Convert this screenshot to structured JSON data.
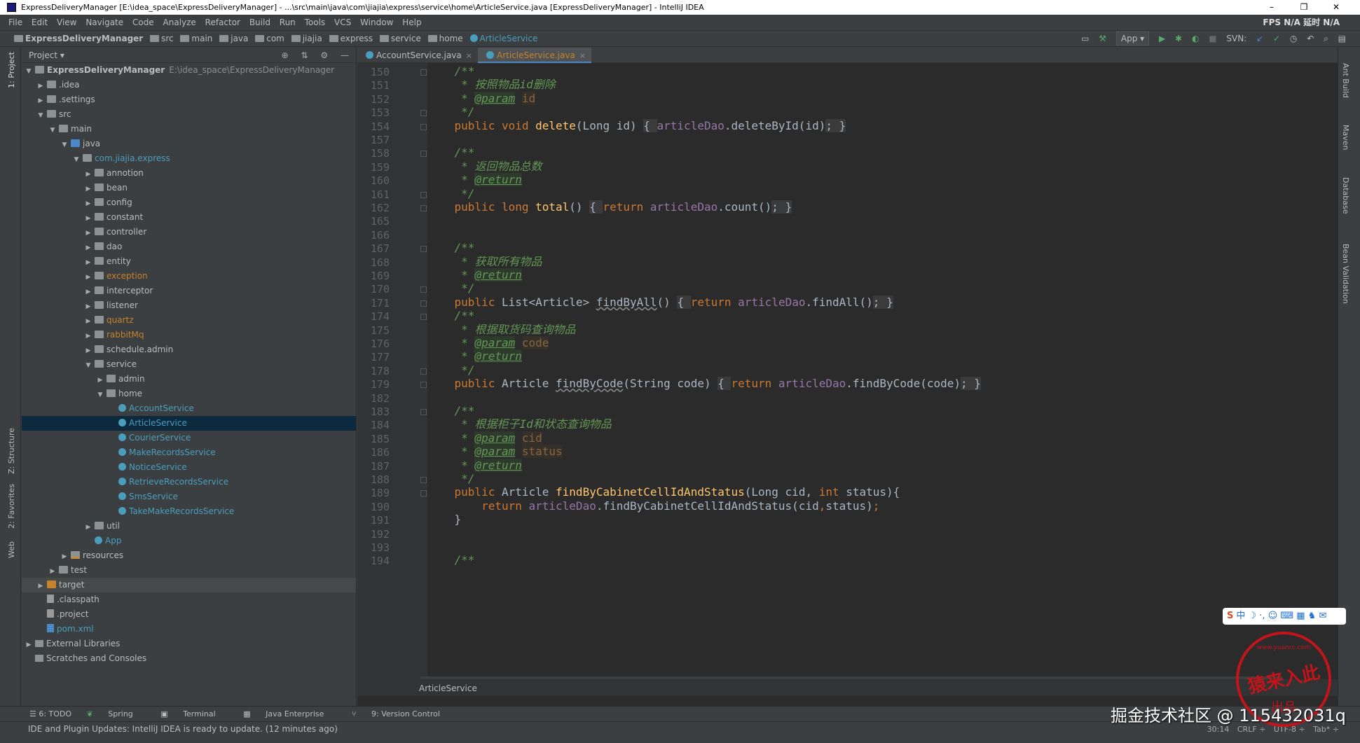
{
  "window": {
    "title": "ExpressDeliveryManager [E:\\idea_space\\ExpressDeliveryManager] - ...\\src\\main\\java\\com\\jiajia\\express\\service\\home\\ArticleService.java [ExpressDeliveryManager] - IntelliJ IDEA",
    "minimize": "–",
    "maximize": "❐",
    "close": "✕"
  },
  "menu": {
    "items": [
      "File",
      "Edit",
      "View",
      "Navigate",
      "Code",
      "Analyze",
      "Refactor",
      "Build",
      "Run",
      "Tools",
      "VCS",
      "Window",
      "Help"
    ],
    "fps": "FPS N/A 延时 N/A"
  },
  "nav": {
    "crumbs": [
      "ExpressDeliveryManager",
      "src",
      "main",
      "java",
      "com",
      "jiajia",
      "express",
      "service",
      "home",
      "ArticleService"
    ],
    "run_config": "App ▾",
    "svn": "SVN:"
  },
  "left_strip": {
    "project": "1: Project",
    "structure": "Z: Structure",
    "favorites": "2: Favorites",
    "web": "Web"
  },
  "right_strip": {
    "ant": "Ant Build",
    "maven": "Maven",
    "database": "Database",
    "bean": "Bean Validation"
  },
  "project_panel": {
    "title": "Project ▾",
    "tree": [
      {
        "depth": 0,
        "arrow": "▼",
        "icon": "folder",
        "label": "ExpressDeliveryManager",
        "path": "E:\\idea_space\\ExpressDeliveryManager",
        "style": "bold"
      },
      {
        "depth": 1,
        "arrow": "▶",
        "icon": "folder",
        "label": ".idea"
      },
      {
        "depth": 1,
        "arrow": "▶",
        "icon": "folder",
        "label": ".settings"
      },
      {
        "depth": 1,
        "arrow": "▼",
        "icon": "folder",
        "label": "src"
      },
      {
        "depth": 2,
        "arrow": "▼",
        "icon": "folder",
        "label": "main"
      },
      {
        "depth": 3,
        "arrow": "▼",
        "icon": "srcf",
        "label": "java"
      },
      {
        "depth": 4,
        "arrow": "▼",
        "icon": "folder",
        "label": "com.jiajia.express",
        "style": "hl"
      },
      {
        "depth": 5,
        "arrow": "▶",
        "icon": "folder",
        "label": "annotion"
      },
      {
        "depth": 5,
        "arrow": "▶",
        "icon": "folder",
        "label": "bean"
      },
      {
        "depth": 5,
        "arrow": "▶",
        "icon": "folder",
        "label": "config"
      },
      {
        "depth": 5,
        "arrow": "▶",
        "icon": "folder",
        "label": "constant"
      },
      {
        "depth": 5,
        "arrow": "▶",
        "icon": "folder",
        "label": "controller"
      },
      {
        "depth": 5,
        "arrow": "▶",
        "icon": "folder",
        "label": "dao"
      },
      {
        "depth": 5,
        "arrow": "▶",
        "icon": "folder",
        "label": "entity"
      },
      {
        "depth": 5,
        "arrow": "▶",
        "icon": "folder",
        "label": "exception",
        "style": "warn"
      },
      {
        "depth": 5,
        "arrow": "▶",
        "icon": "folder",
        "label": "interceptor"
      },
      {
        "depth": 5,
        "arrow": "▶",
        "icon": "folder",
        "label": "listener"
      },
      {
        "depth": 5,
        "arrow": "▶",
        "icon": "folder",
        "label": "quartz",
        "style": "warn"
      },
      {
        "depth": 5,
        "arrow": "▶",
        "icon": "folder",
        "label": "rabbitMq",
        "style": "warn"
      },
      {
        "depth": 5,
        "arrow": "▶",
        "icon": "folder",
        "label": "schedule.admin"
      },
      {
        "depth": 5,
        "arrow": "▼",
        "icon": "folder",
        "label": "service"
      },
      {
        "depth": 6,
        "arrow": "▶",
        "icon": "folder",
        "label": "admin"
      },
      {
        "depth": 6,
        "arrow": "▼",
        "icon": "folder",
        "label": "home"
      },
      {
        "depth": 7,
        "arrow": "",
        "icon": "cls",
        "label": "AccountService",
        "style": "hl"
      },
      {
        "depth": 7,
        "arrow": "",
        "icon": "cls",
        "label": "ArticleService",
        "style": "hl",
        "selected": true
      },
      {
        "depth": 7,
        "arrow": "",
        "icon": "cls",
        "label": "CourierService",
        "style": "hl"
      },
      {
        "depth": 7,
        "arrow": "",
        "icon": "cls",
        "label": "MakeRecordsService",
        "style": "hl"
      },
      {
        "depth": 7,
        "arrow": "",
        "icon": "cls",
        "label": "NoticeService",
        "style": "hl"
      },
      {
        "depth": 7,
        "arrow": "",
        "icon": "cls",
        "label": "RetrieveRecordsService",
        "style": "hl"
      },
      {
        "depth": 7,
        "arrow": "",
        "icon": "cls",
        "label": "SmsService",
        "style": "hl"
      },
      {
        "depth": 7,
        "arrow": "",
        "icon": "cls",
        "label": "TakeMakeRecordsService",
        "style": "hl"
      },
      {
        "depth": 5,
        "arrow": "▶",
        "icon": "folder",
        "label": "util"
      },
      {
        "depth": 5,
        "arrow": "",
        "icon": "cls",
        "label": "App",
        "style": "hl"
      },
      {
        "depth": 3,
        "arrow": "▶",
        "icon": "resf",
        "label": "resources"
      },
      {
        "depth": 2,
        "arrow": "▶",
        "icon": "folder",
        "label": "test"
      },
      {
        "depth": 1,
        "arrow": "▶",
        "icon": "orange",
        "label": "target",
        "dim": true
      },
      {
        "depth": 1,
        "arrow": "",
        "icon": "file",
        "label": ".classpath"
      },
      {
        "depth": 1,
        "arrow": "",
        "icon": "file",
        "label": ".project"
      },
      {
        "depth": 1,
        "arrow": "",
        "icon": "mvn",
        "label": "pom.xml",
        "style": "hl"
      },
      {
        "depth": 0,
        "arrow": "▶",
        "icon": "lib",
        "label": "External Libraries"
      },
      {
        "depth": 0,
        "arrow": "",
        "icon": "lib",
        "label": "Scratches and Consoles"
      }
    ]
  },
  "editor": {
    "tabs": [
      {
        "label": "AccountService.java",
        "active": false
      },
      {
        "label": "ArticleService.java",
        "active": true
      }
    ],
    "tab_close": "×",
    "lines": [
      {
        "n": "150",
        "fold": true,
        "segs": [
          [
            "    ",
            ""
          ],
          [
            "/**",
            "cm"
          ]
        ]
      },
      {
        "n": "151",
        "segs": [
          [
            "     ",
            ""
          ],
          [
            "* 按照物品id删除",
            "cm"
          ]
        ]
      },
      {
        "n": "152",
        "segs": [
          [
            "     ",
            ""
          ],
          [
            "* ",
            "cm"
          ],
          [
            "@param",
            "tag"
          ],
          [
            " ",
            ""
          ],
          [
            "id",
            "pr"
          ]
        ]
      },
      {
        "n": "153",
        "fold": true,
        "segs": [
          [
            "     ",
            ""
          ],
          [
            "*/",
            "cm"
          ]
        ]
      },
      {
        "n": "154",
        "fold": true,
        "segs": [
          [
            "    ",
            ""
          ],
          [
            "public void ",
            "kw"
          ],
          [
            "delete",
            "fn"
          ],
          [
            "(Long id) ",
            ""
          ],
          [
            "{ ",
            "gry"
          ],
          [
            "articleDao",
            "fld"
          ],
          [
            ".deleteById(id)",
            ""
          ],
          [
            "; }",
            "gry"
          ]
        ]
      },
      {
        "n": "157",
        "segs": []
      },
      {
        "n": "158",
        "fold": true,
        "segs": [
          [
            "    ",
            ""
          ],
          [
            "/**",
            "cm"
          ]
        ]
      },
      {
        "n": "159",
        "segs": [
          [
            "     ",
            ""
          ],
          [
            "* 返回物品总数",
            "cm"
          ]
        ]
      },
      {
        "n": "160",
        "segs": [
          [
            "     ",
            ""
          ],
          [
            "* ",
            "cm"
          ],
          [
            "@return",
            "tag"
          ]
        ]
      },
      {
        "n": "161",
        "fold": true,
        "segs": [
          [
            "     ",
            ""
          ],
          [
            "*/",
            "cm"
          ]
        ]
      },
      {
        "n": "162",
        "fold": true,
        "segs": [
          [
            "    ",
            ""
          ],
          [
            "public long ",
            "kw"
          ],
          [
            "total",
            "fn"
          ],
          [
            "() ",
            ""
          ],
          [
            "{ ",
            "gry"
          ],
          [
            "return ",
            "kw"
          ],
          [
            "articleDao",
            "fld"
          ],
          [
            ".count()",
            ""
          ],
          [
            "; }",
            "gry"
          ]
        ]
      },
      {
        "n": "165",
        "segs": []
      },
      {
        "n": "166",
        "segs": []
      },
      {
        "n": "167",
        "fold": true,
        "segs": [
          [
            "    ",
            ""
          ],
          [
            "/**",
            "cm"
          ]
        ]
      },
      {
        "n": "168",
        "segs": [
          [
            "     ",
            ""
          ],
          [
            "* 获取所有物品",
            "cm"
          ]
        ]
      },
      {
        "n": "169",
        "segs": [
          [
            "     ",
            ""
          ],
          [
            "* ",
            "cm"
          ],
          [
            "@return",
            "tag"
          ]
        ]
      },
      {
        "n": "170",
        "fold": true,
        "segs": [
          [
            "     ",
            ""
          ],
          [
            "*/",
            "cm"
          ]
        ]
      },
      {
        "n": "171",
        "fold": true,
        "segs": [
          [
            "    ",
            ""
          ],
          [
            "public ",
            "kw"
          ],
          [
            "List<Article> ",
            ""
          ],
          [
            "findByAll",
            "ul"
          ],
          [
            "() ",
            ""
          ],
          [
            "{ ",
            "gry"
          ],
          [
            "return ",
            "kw"
          ],
          [
            "articleDao",
            "fld"
          ],
          [
            ".findAll()",
            ""
          ],
          [
            "; }",
            "gry"
          ]
        ]
      },
      {
        "n": "174",
        "fold": true,
        "segs": [
          [
            "    ",
            ""
          ],
          [
            "/**",
            "cm"
          ]
        ]
      },
      {
        "n": "175",
        "segs": [
          [
            "     ",
            ""
          ],
          [
            "* 根据取货码查询物品",
            "cm"
          ]
        ]
      },
      {
        "n": "176",
        "segs": [
          [
            "     ",
            ""
          ],
          [
            "* ",
            "cm"
          ],
          [
            "@param",
            "tag"
          ],
          [
            " ",
            ""
          ],
          [
            "code",
            "pr"
          ]
        ]
      },
      {
        "n": "177",
        "segs": [
          [
            "     ",
            ""
          ],
          [
            "* ",
            "cm"
          ],
          [
            "@return",
            "tag"
          ]
        ]
      },
      {
        "n": "178",
        "fold": true,
        "segs": [
          [
            "     ",
            ""
          ],
          [
            "*/",
            "cm"
          ]
        ]
      },
      {
        "n": "179",
        "fold": true,
        "segs": [
          [
            "    ",
            ""
          ],
          [
            "public ",
            "kw"
          ],
          [
            "Article ",
            ""
          ],
          [
            "findByCode",
            "ul"
          ],
          [
            "(String code) ",
            ""
          ],
          [
            "{ ",
            "gry"
          ],
          [
            "return ",
            "kw"
          ],
          [
            "articleDao",
            "fld"
          ],
          [
            ".findByCode(code)",
            ""
          ],
          [
            "; }",
            "gry"
          ]
        ]
      },
      {
        "n": "182",
        "segs": []
      },
      {
        "n": "183",
        "fold": true,
        "segs": [
          [
            "    ",
            ""
          ],
          [
            "/**",
            "cm"
          ]
        ]
      },
      {
        "n": "184",
        "segs": [
          [
            "     ",
            ""
          ],
          [
            "* 根据柜子Id和状态查询物品",
            "cm"
          ]
        ]
      },
      {
        "n": "185",
        "segs": [
          [
            "     ",
            ""
          ],
          [
            "* ",
            "cm"
          ],
          [
            "@param",
            "tag"
          ],
          [
            " ",
            ""
          ],
          [
            "cid",
            "pr"
          ]
        ]
      },
      {
        "n": "186",
        "segs": [
          [
            "     ",
            ""
          ],
          [
            "* ",
            "cm"
          ],
          [
            "@param",
            "tag"
          ],
          [
            " ",
            ""
          ],
          [
            "status",
            "pr"
          ]
        ]
      },
      {
        "n": "187",
        "segs": [
          [
            "     ",
            ""
          ],
          [
            "* ",
            "cm"
          ],
          [
            "@return",
            "tag"
          ]
        ]
      },
      {
        "n": "188",
        "fold": true,
        "segs": [
          [
            "     ",
            ""
          ],
          [
            "*/",
            "cm"
          ]
        ]
      },
      {
        "n": "189",
        "fold": true,
        "segs": [
          [
            "    ",
            ""
          ],
          [
            "public ",
            "kw"
          ],
          [
            "Article ",
            ""
          ],
          [
            "findByCabinetCellIdAndStatus",
            "fn"
          ],
          [
            "(Long cid, ",
            ""
          ],
          [
            "int ",
            "kw"
          ],
          [
            "status){",
            ""
          ]
        ]
      },
      {
        "n": "190",
        "segs": [
          [
            "        ",
            ""
          ],
          [
            "return ",
            "kw"
          ],
          [
            "articleDao",
            "fld"
          ],
          [
            ".findByCabinetCellIdAndStatus(cid",
            ""
          ],
          [
            ",",
            "kw"
          ],
          [
            "status)",
            ""
          ],
          [
            ";",
            "kw"
          ]
        ]
      },
      {
        "n": "191",
        "segs": [
          [
            "    }",
            ""
          ]
        ]
      },
      {
        "n": "192",
        "segs": []
      },
      {
        "n": "193",
        "segs": []
      },
      {
        "n": "194",
        "segs": [
          [
            "    ",
            ""
          ],
          [
            "/**",
            "cm"
          ]
        ]
      }
    ],
    "breadcrumb": "ArticleService"
  },
  "bottom_tools": [
    "☰ 6: TODO",
    "Spring",
    "Terminal",
    "Java Enterprise",
    "9: Version Control"
  ],
  "status": {
    "message": "IDE and Plugin Updates: IntelliJ IDEA is ready to update. (12 minutes ago)",
    "position": "30:14",
    "line_sep": "CRLF ÷",
    "encoding": "UTF-8 ÷",
    "indent": "Tab* ÷"
  },
  "overlay": {
    "watermark": "掘金技术社区 @ 115432031q",
    "stamp_top": "www.yuanrc.com",
    "stamp_main": "猿来入此",
    "stamp_bottom": "出品",
    "ime": "中 ☽ ·, ☺ ⌨ ▦ ♞ ✉"
  }
}
